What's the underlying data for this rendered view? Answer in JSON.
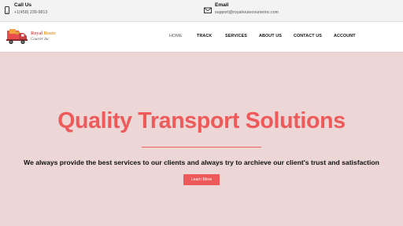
{
  "topbar": {
    "call": {
      "icon": "phone-icon",
      "title": "Call Us",
      "value": "+1(458) 239-9813"
    },
    "email": {
      "icon": "envelope-icon",
      "title": "Email",
      "value": "support@royalroutecourierinc.com"
    }
  },
  "logo": {
    "line1_a": "Royal ",
    "line1_b": "Route",
    "line2": "Courier Inc"
  },
  "nav": {
    "home": "HOME",
    "track": "TRACK",
    "services": "SERVICES",
    "about": "ABOUT US",
    "contact": "CONTACT US",
    "account": "ACCOUNT"
  },
  "hero": {
    "title": "Quality Transport Solutions",
    "subtitle": "We always provide the best services to our clients and always try to archieve our client's trust and satisfaction",
    "button": "Learn More"
  },
  "colors": {
    "accent": "#ee5a5a",
    "hero_bg": "#ecd6d6",
    "topbar_bg": "#f3f3f3"
  }
}
